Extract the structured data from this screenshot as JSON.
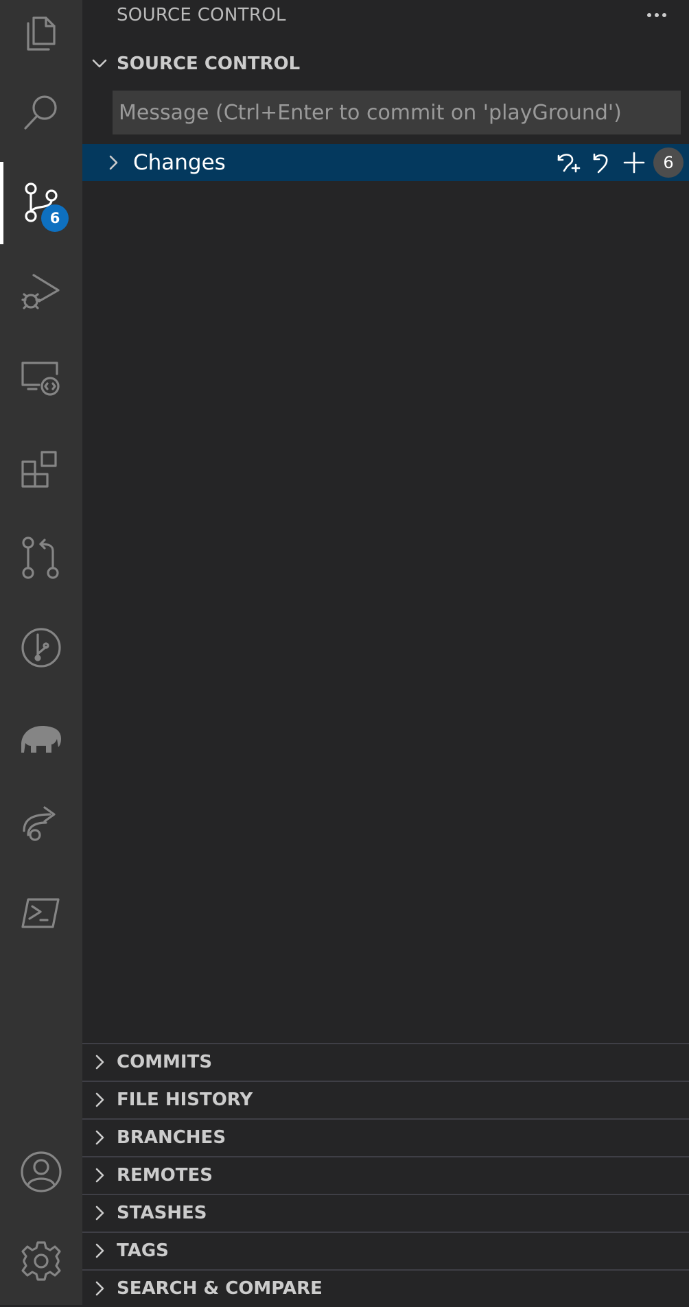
{
  "sidebar": {
    "title": "SOURCE CONTROL",
    "section_title": "SOURCE CONTROL",
    "commit_placeholder": "Message (Ctrl+Enter to commit on 'playGround')",
    "changes": {
      "label": "Changes",
      "count": "6"
    }
  },
  "activity_bar": {
    "scm_badge": "6",
    "items": [
      "files-icon",
      "search-icon",
      "source-control-icon",
      "run-debug-icon",
      "remote-explorer-icon",
      "extensions-icon",
      "pull-requests-icon",
      "git-graph-icon",
      "gradle-icon",
      "live-share-icon",
      "powershell-icon",
      "accounts-icon",
      "settings-gear-icon"
    ]
  },
  "panes": [
    {
      "label": "COMMITS"
    },
    {
      "label": "FILE HISTORY"
    },
    {
      "label": "BRANCHES"
    },
    {
      "label": "REMOTES"
    },
    {
      "label": "STASHES"
    },
    {
      "label": "TAGS"
    },
    {
      "label": "SEARCH & COMPARE"
    }
  ],
  "colors": {
    "accent": "#0e70c0",
    "selected_row": "#04395e",
    "activity_bar": "#333333",
    "sidebar": "#252526"
  }
}
